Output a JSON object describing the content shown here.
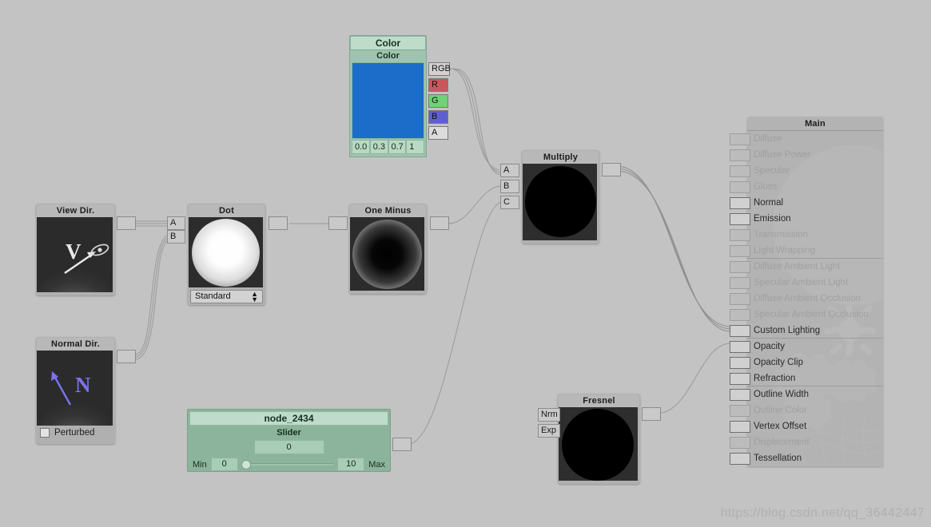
{
  "editor": {
    "background_color": "#c3c3c3",
    "watermark": "https://blog.csdn.net/qq_36442447"
  },
  "nodes": {
    "color": {
      "title": "Color",
      "sub_title": "Color",
      "swatch_color": "#1b6dc9",
      "values": [
        "0.0",
        "0.3",
        "0.7",
        "1"
      ],
      "outputs": [
        {
          "label": "RGB",
          "color": "#d2d2d2"
        },
        {
          "label": "R",
          "color": "#c9575c"
        },
        {
          "label": "G",
          "color": "#6fd178"
        },
        {
          "label": "B",
          "color": "#5f5fcf"
        },
        {
          "label": "A",
          "color": "#dcdcdc"
        }
      ]
    },
    "view_dir": {
      "title": "View Dir.",
      "glyph": "V",
      "icon": "eye-icon"
    },
    "normal_dir": {
      "title": "Normal Dir.",
      "glyph": "N",
      "checkbox_label": "Perturbed",
      "checkbox_checked": false
    },
    "dot": {
      "title": "Dot",
      "inputs": [
        "A",
        "B"
      ],
      "dropdown_value": "Standard"
    },
    "one_minus": {
      "title": "One Minus"
    },
    "multiply": {
      "title": "Multiply",
      "inputs": [
        "A",
        "B",
        "C"
      ]
    },
    "fresnel": {
      "title": "Fresnel",
      "inputs": [
        "Nrm",
        "Exp"
      ]
    },
    "slider": {
      "title": "node_2434",
      "sub_title": "Slider",
      "value": "0",
      "min_label": "Min",
      "min_value": "0",
      "max_value": "10",
      "max_label": "Max",
      "handle_percent": 0
    },
    "main": {
      "title": "Main",
      "rows": [
        {
          "label": "Diffuse",
          "enabled": false
        },
        {
          "label": "Diffuse Power",
          "enabled": false
        },
        {
          "label": "Specular",
          "enabled": false
        },
        {
          "label": "Gloss",
          "enabled": false
        },
        {
          "label": "Normal",
          "enabled": true
        },
        {
          "label": "Emission",
          "enabled": true
        },
        {
          "label": "Transmission",
          "enabled": false
        },
        {
          "label": "Light Wrapping",
          "enabled": false,
          "separator_after": true
        },
        {
          "label": "Diffuse Ambient Light",
          "enabled": false
        },
        {
          "label": "Specular Ambient Light",
          "enabled": false
        },
        {
          "label": "Diffuse Ambient Occlusion",
          "enabled": false
        },
        {
          "label": "Specular Ambient Occlusion",
          "enabled": false
        },
        {
          "label": "Custom Lighting",
          "enabled": true,
          "separator_after": true
        },
        {
          "label": "Opacity",
          "enabled": true
        },
        {
          "label": "Opacity Clip",
          "enabled": true
        },
        {
          "label": "Refraction",
          "enabled": true,
          "separator_after": true
        },
        {
          "label": "Outline Width",
          "enabled": true
        },
        {
          "label": "Outline Color",
          "enabled": false
        },
        {
          "label": "Vertex Offset",
          "enabled": true
        },
        {
          "label": "Displacement",
          "enabled": false
        },
        {
          "label": "Tessellation",
          "enabled": true
        }
      ]
    }
  }
}
